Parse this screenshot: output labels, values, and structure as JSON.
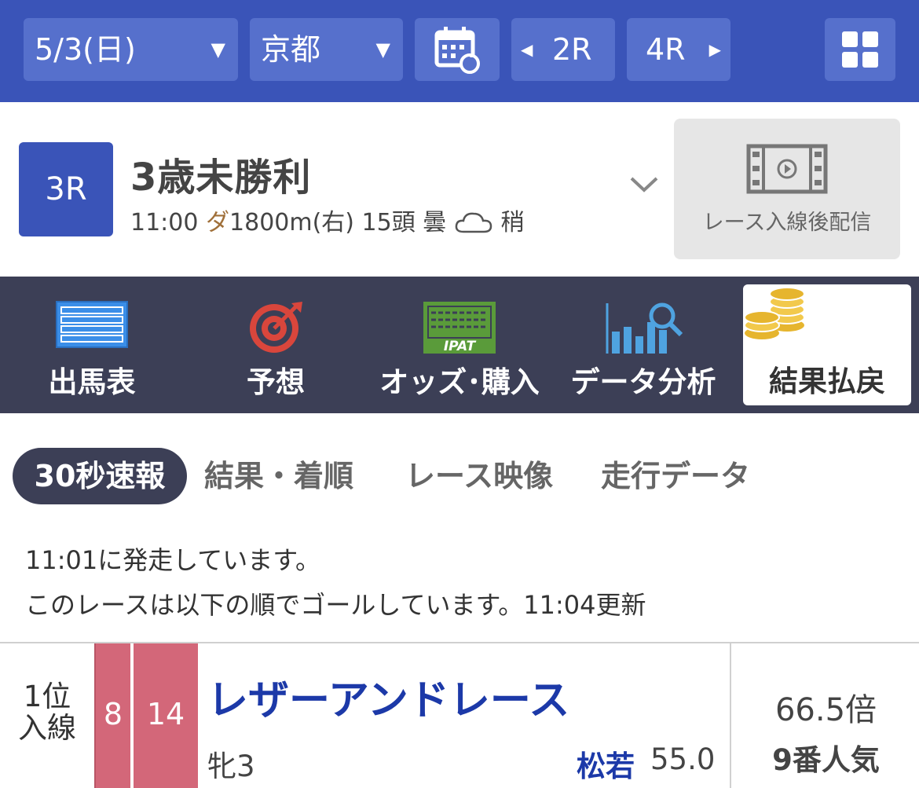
{
  "topbar": {
    "date": "5/3(日)",
    "venue": "京都",
    "prev_race": "2R",
    "next_race": "4R",
    "caret": "▼",
    "prev_arrow": "◀",
    "next_arrow": "▶",
    "accent_color": "#3a54b8"
  },
  "race": {
    "number": "3R",
    "name": "3歳未勝利",
    "time": "11:00",
    "surface": "ダ",
    "distance": "1800m(右)",
    "runners": "15頭",
    "weather": "曇",
    "going": "稍",
    "video_label": "レース入線後配信"
  },
  "nav": [
    {
      "label": "出馬表",
      "icon": "entry-table-icon"
    },
    {
      "label": "予想",
      "icon": "target-icon"
    },
    {
      "label": "オッズ･購入",
      "icon": "ipat-icon"
    },
    {
      "label": "データ分析",
      "icon": "chart-search-icon"
    },
    {
      "label": "結果払戻",
      "icon": "coins-icon",
      "active": true
    }
  ],
  "subtabs": [
    "30秒速報",
    "結果・着順",
    "レース映像",
    "走行データ"
  ],
  "messages": {
    "start": "11:01に発走しています。",
    "goal": "このレースは以下の順でゴールしています。11:04更新"
  },
  "results": [
    {
      "rank_line1": "1位",
      "rank_line2": "入線",
      "frame": "8",
      "horse_number": "14",
      "horse_name": "レザーアンドレース",
      "sex_age": "牝3",
      "jockey": "松若",
      "weight": "55.0",
      "odds": "66.5倍",
      "popularity": "9番人気",
      "frame_color": "#d36779"
    }
  ]
}
